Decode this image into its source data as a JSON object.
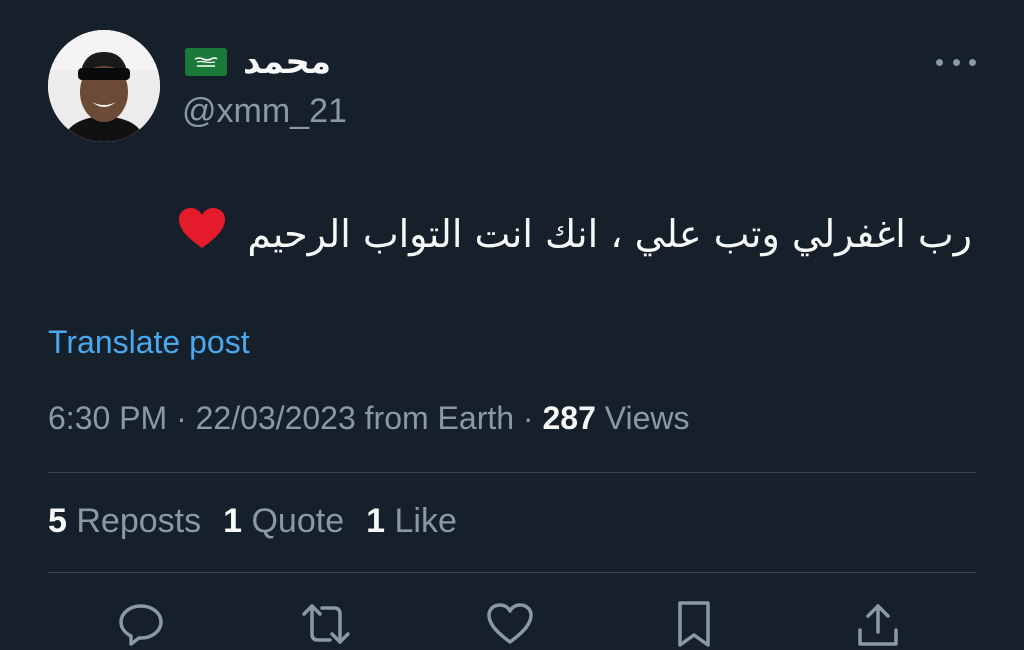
{
  "colors": {
    "background": "#15202b",
    "text": "#f7f9f9",
    "muted": "#8b98a5",
    "link": "#4aa8ee",
    "divider": "#38444d",
    "heart": "#e31b2a"
  },
  "author": {
    "display_name": "محمد",
    "flag_icon": "saudi-flag",
    "handle": "@xmm_21"
  },
  "tweet": {
    "text": "رب اغفرلي وتب علي ، انك انت التواب الرحيم",
    "emoji": "red-heart"
  },
  "translate_label": "Translate post",
  "meta": {
    "time": "6:30 PM",
    "sep1": " · ",
    "date": "22/03/2023",
    "source": " from Earth",
    "sep2": " · ",
    "views_count": "287",
    "views_label": " Views"
  },
  "stats": {
    "reposts_count": "5",
    "reposts_label": " Reposts",
    "quotes_count": "1",
    "quotes_label": " Quote",
    "likes_count": "1",
    "likes_label": " Like"
  },
  "actions": [
    "reply-icon",
    "repost-icon",
    "like-icon",
    "bookmark-icon",
    "share-icon"
  ]
}
